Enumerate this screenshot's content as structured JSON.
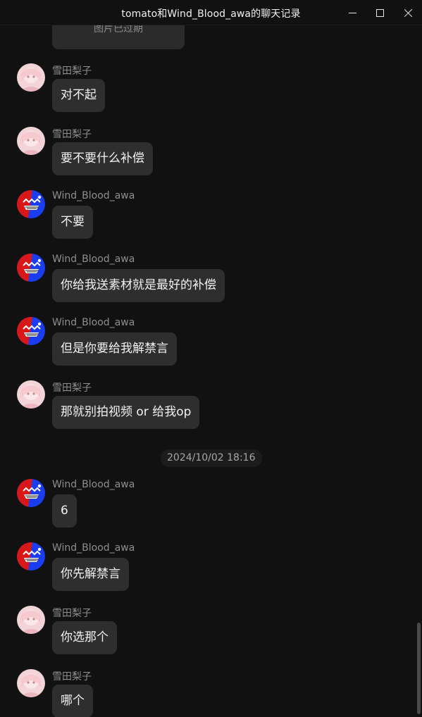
{
  "window": {
    "title": "tomato和Wind_Blood_awa的聊天记录",
    "minimize_icon": "minimize-icon",
    "maximize_icon": "maximize-icon",
    "close_icon": "close-icon"
  },
  "expired_image": {
    "label": "图片已过期"
  },
  "timestamp": "2024/10/02 18:16",
  "colors": {
    "background": "#111111",
    "bubble": "#2e2e2e",
    "sender_text": "#8e8e8e",
    "message_text": "#f2f2f2"
  },
  "messages": [
    {
      "sender": "雪田梨子",
      "text": "对不起",
      "avatar": "pink-anime-avatar"
    },
    {
      "sender": "雪田梨子",
      "text": "要不要什么补偿",
      "avatar": "pink-anime-avatar"
    },
    {
      "sender": "Wind_Blood_awa",
      "text": "不要",
      "avatar": "red-blue-avatar"
    },
    {
      "sender": "Wind_Blood_awa",
      "text": "你给我送素材就是最好的补偿",
      "avatar": "red-blue-avatar"
    },
    {
      "sender": "Wind_Blood_awa",
      "text": "但是你要给我解禁言",
      "avatar": "red-blue-avatar"
    },
    {
      "sender": "雪田梨子",
      "text": "那就别拍视频 or 给我op",
      "avatar": "pink-anime-avatar"
    },
    {
      "sender": "Wind_Blood_awa",
      "text": "6",
      "avatar": "red-blue-avatar"
    },
    {
      "sender": "Wind_Blood_awa",
      "text": "你先解禁言",
      "avatar": "red-blue-avatar"
    },
    {
      "sender": "雪田梨子",
      "text": "你选那个",
      "avatar": "pink-anime-avatar"
    },
    {
      "sender": "雪田梨子",
      "text": "哪个",
      "avatar": "pink-anime-avatar"
    }
  ]
}
